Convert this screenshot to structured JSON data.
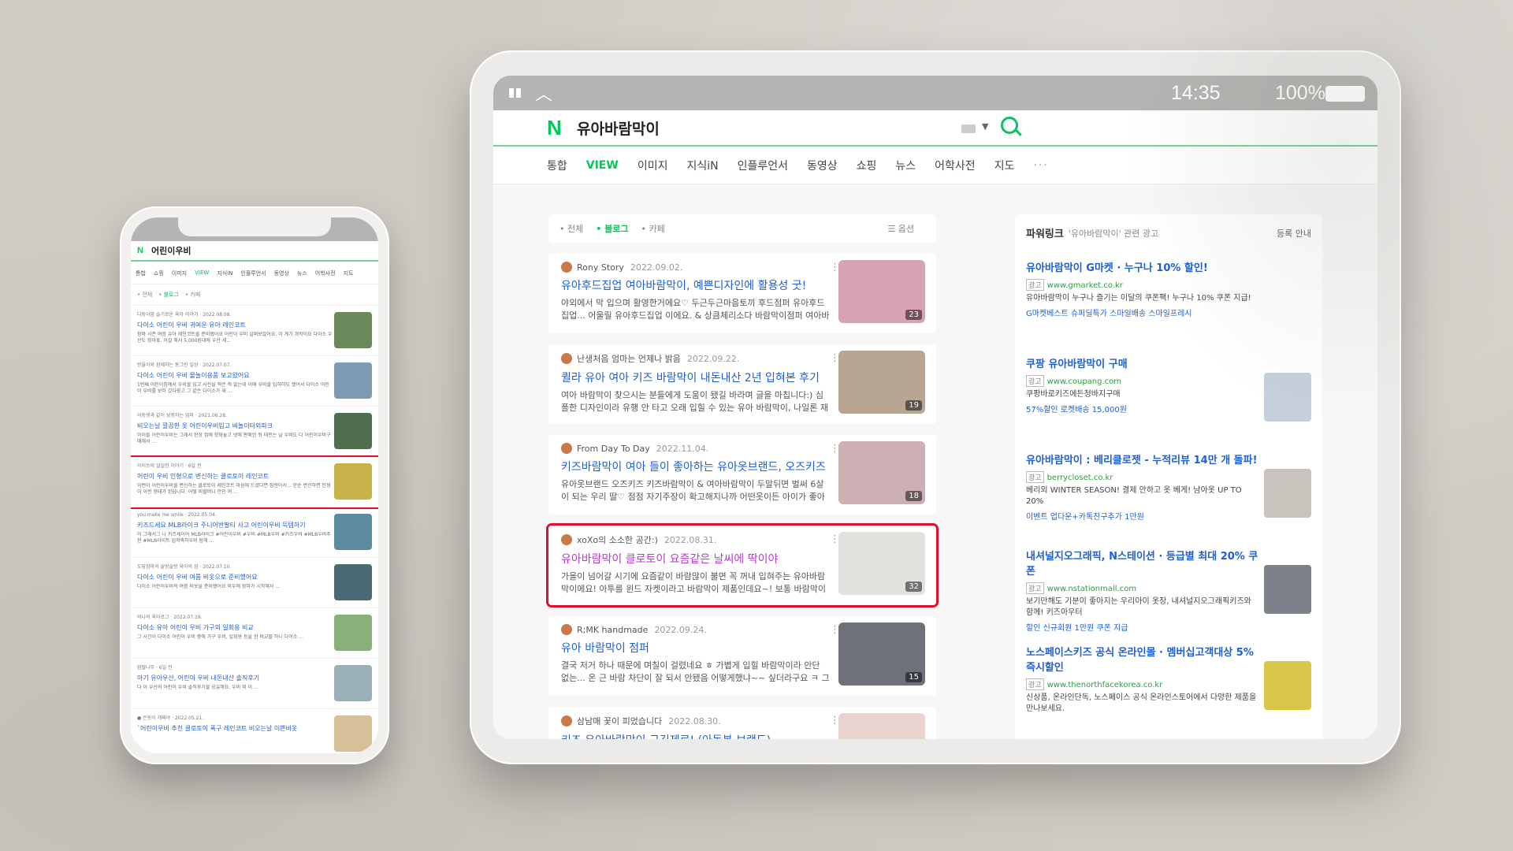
{
  "tablet": {
    "status": {
      "time": "14:35",
      "battery": "100%"
    },
    "header": {
      "logo": "N",
      "query": "유아바람막이"
    },
    "tabs": [
      {
        "label": "통합",
        "active": false
      },
      {
        "label": "VIEW",
        "active": true
      },
      {
        "label": "이미지",
        "active": false
      },
      {
        "label": "지식iN",
        "active": false
      },
      {
        "label": "인플루언서",
        "active": false
      },
      {
        "label": "동영상",
        "active": false
      },
      {
        "label": "쇼핑",
        "active": false
      },
      {
        "label": "뉴스",
        "active": false
      },
      {
        "label": "어학사전",
        "active": false
      },
      {
        "label": "지도",
        "active": false
      },
      {
        "label": "···",
        "active": false
      }
    ],
    "filter": {
      "all": "• 전체",
      "blog": "• 블로그",
      "cafe": "• 카페",
      "option": "☰ 옵션"
    },
    "results": [
      {
        "author": "Rony Story",
        "date": "2022.09.02.",
        "title": "유아후드집업 여아바람막이, 예쁜디자인에 활용성 굿!",
        "desc": "야외에서 막 입으며 활영한거에요♡ 두근두근마음토끼 후드점퍼 유아후드집업... 어울릴 유아후드집업 이에요. & 상큼체리소다 바람막이점퍼 여아바람막이 은 아이...",
        "count": "23",
        "selected": false,
        "img": "#d9a3b6"
      },
      {
        "author": "난생처음 엄마는 언제나 밝음",
        "date": "2022.09.22.",
        "title": "퀼라 유아 여아 키즈 바람막이 내돈내산 2년 입혀본 후기",
        "desc": "여아 바람막이 찾으시는 분들에게 도움이 됐길 바라며 글을 마칩니다:) 심플한 디자인이라 유행 안 타고 오래 입힐 수 있는 유아 바람막이, 나일론 재질이라 바람을...",
        "count": "19",
        "selected": false,
        "img": "#b8a592"
      },
      {
        "author": "From Day To Day",
        "date": "2022.11.04.",
        "title": "키즈바람막이 여아 들이 좋아하는 유아옷브랜드, 오즈키즈",
        "desc": "유아옷브랜드 오즈키즈 키즈바람막이 & 여아바람막이 두말뒤면 벌써 6살이 되는 우리 딸♡ 점점 자기주장이 확고해지나까 어떤옷이든 아이가 좋아할만한 디자인...",
        "count": "18",
        "selected": false,
        "img": "#cdb0b4"
      },
      {
        "author": "xoXo의 소소한 공간:)",
        "date": "2022.08.31.",
        "title": "유아바람막이 클로토이 요즘같은 날씨에 딱이야",
        "desc": "가을이 넘어갈 시기에 요즘같이 바람많이 불면 꼭 꺼내 입혀주는 유아바람막이에요! 아투를 윈드 자켓이라고 바람막이 제품인데요~! 보통 바람막이는 따로 파우치...",
        "count": "32",
        "selected": true,
        "img": "#e4e2df"
      },
      {
        "author": "R;MK handmade",
        "date": "2022.09.24.",
        "title": "유아 바람막이 점퍼",
        "desc": "결국 저거 하나 때문에 며칠이 걸렸네요 ㅎ 가볍게 입힐 바람막이라 안단 없는... 온 근 바람 차단이 잘 되서 안됐음 어떻게했냐~~ 싶더라구요 ㅋ 그냥 장식용 디힘과...",
        "count": "15",
        "selected": false,
        "img": "#6f7179"
      },
      {
        "author": "삼남매 꽃이 피었습니다",
        "date": "2022.08.30.",
        "title": "키즈 유아바람막이 구김제로! (아동복 브랜드)",
        "desc": "",
        "count": "",
        "selected": false,
        "img": "#e8d3ce"
      }
    ],
    "sidebar": {
      "title": "파워링크",
      "subtitle": "'유아바람막이' 관련 광고",
      "guide": "등록 안내",
      "ads": [
        {
          "title": "유아바람막이 G마켓 · 누구나 10% 할인!",
          "badge": "광고",
          "url": "www.gmarket.co.kr",
          "desc": "유아바람막이 누구나 즐기는 이달의 쿠폰팩! 누구나 10% 쿠폰 지급!",
          "ext": "G마켓베스트  슈퍼딜특가  스마일배송  스마일프레시",
          "img": ""
        },
        {
          "title": "쿠팡 유아바람막이 구매",
          "badge": "광고",
          "url": "www.coupang.com",
          "desc": "쿠팡바로키즈에든청바지구매",
          "ext": "57%할인 로켓배송    15,000원",
          "img": "#c6d0dc"
        },
        {
          "title": "유아바람막이 : 베리클로젯 - 누적리뷰 14만 개 돌파!",
          "badge": "광고",
          "url": "berrycloset.co.kr",
          "desc": "베리외 WINTER SEASON! 결제 안하고 옷 베게! 남아옷 UP TO 20%",
          "ext": "이벤트  업다운+카톡친구추가 1만원",
          "img": "#c9c3bd"
        },
        {
          "title": "내셔널지오그래픽, N스테이션 · 등급별 최대 20% 쿠폰",
          "badge": "광고",
          "url": "www.nstationmall.com",
          "desc": "보기만해도 기분이 좋아지는 우리아이 옷장, 내셔널지오그래픽키즈와 함께! 키즈아우터",
          "ext": "할인  신규회원 1만원 쿠폰 지급",
          "img": "#7d8189"
        },
        {
          "title": "노스페이스키즈 공식 온라인몰 · 멤버십고객대상 5% 즉시할인",
          "badge": "광고",
          "url": "www.thenorthfacekorea.co.kr",
          "desc": "신상품, 온라인단독, 노스페이스 공식 온라인스토어에서 다양한 제품을 만나보세요.",
          "ext": "",
          "img": "#d8c748"
        }
      ]
    }
  },
  "phone": {
    "query": "어린이우비",
    "logo": "N",
    "tabs": [
      {
        "label": "통합",
        "active": false
      },
      {
        "label": "쇼핑",
        "active": false
      },
      {
        "label": "이미지",
        "active": false
      },
      {
        "label": "VIEW",
        "active": true
      },
      {
        "label": "지식iN",
        "active": false
      },
      {
        "label": "인플루언서",
        "active": false
      },
      {
        "label": "동영상",
        "active": false
      },
      {
        "label": "뉴스",
        "active": false
      },
      {
        "label": "어학사전",
        "active": false
      },
      {
        "label": "지도",
        "active": false
      }
    ],
    "filter": {
      "all": "• 전체",
      "blog": "• 블로그",
      "cafe": "• 카페"
    },
    "results": [
      {
        "meta": "다둥이맘 슬기로운 육아 이야기 · 2022.08.08.",
        "title": "다이소 어린이 우비 귀여운 유아 레인코트",
        "desc": "장마 시즌 여름 유아 레인코트를 준비했어요 어린이 우비 살펴보았어요. 이 계기 개학이요 다이소 우산도 장마표. 이걸 해서 5,000원대에 우산 세...",
        "selected": false,
        "img": "#6a8a5c"
      },
      {
        "meta": "방울이와 함께하는 동그란 일상 · 2022.07.07.",
        "title": "다이소 어린이 우비 물놀이용품 보고왔어요",
        "desc": "1번째 어린이집에서 우비를 입고 사진을 찍은 적 없는데 이때 우비를 입혀야도 했어서 다이소 어린이 우비를 보러 갔다왔고 그 같은 다이소가 새 ...",
        "selected": false,
        "img": "#7d9bb2"
      },
      {
        "meta": "아동생과 같이 성장하는 엄마 · 2021.06.28.",
        "title": "비오는날 깔끔한 옷 어린이우비입고 비놀이터외파크",
        "desc": "아이들 어린이우비는 그래서 현상 집에 장화놓고 넷에 판매한 뒤 테린는 날 우비도 다 어린이우비구매해서 ...",
        "selected": false,
        "img": "#506f4e"
      },
      {
        "meta": "아이쓰의 일일한 이야기 · 6일 전",
        "title": "어린이 우비 인형으로 변신하는 클로토이 레인코트",
        "desc": "이번이 어린이우비를 변신하는 클로토이 레인코트 마음에 드셨다면 집엔아서... 한순 변신하면 인형이 이런 형태가 된답니다. 어떻 외할머니 안인 여 ...",
        "selected": true,
        "img": "#c9b24a"
      },
      {
        "meta": "you make me smile · 2022.05.04.",
        "title": "키즈드세요 MLB라이크 주니어반팔티 사고 어린이우비 득템하기",
        "desc": "이 그래서그 나 키즈세이어 MLB라이크 #어린이우비 #우비 #MLB우비 #키즈우비 #MLB우비추천 #MLB라이트 입학축하우비 탐해 ...",
        "selected": false,
        "img": "#5d8a9e"
      },
      {
        "meta": "도담엄마의 솔방솔방 육아의 섬 · 2022.07.10.",
        "title": "다이소 어린이 우비 여름 비옷으로 준비했어요",
        "desc": "다이소 어린이우비의 여름 비옷을 준비했어요 비우에 장마가 시작해서 ...",
        "selected": false,
        "img": "#4a6a74"
      },
      {
        "meta": "비나의 육아로그 · 2022.07.19.",
        "title": "다이소 유아 어린이 우비 가구의 일회용 비교",
        "desc": "그 시간이 다이소 어린이 우비 중에 가구 우비, 일회용 등을 한 비교를 하니 다이소 ...",
        "selected": false,
        "img": "#8ab07a"
      },
      {
        "meta": "맘딸나무 · 6일 전",
        "title": "아기 유아우산, 어린이 우비 내돈내산 솔직후기",
        "desc": "다 이 우산의 어린이 우비 솔직후기를 공유해요. 우비 외 이 ...",
        "selected": false,
        "img": "#9ab0b8"
      },
      {
        "meta": "● 은동이 개찌야 · 2022.05.21.",
        "title": "`어린이우비 추천 클로토이 폭구 레인코트 비오는날 이쁜비옷",
        "desc": "",
        "selected": false,
        "img": "#d6c09a"
      }
    ]
  }
}
